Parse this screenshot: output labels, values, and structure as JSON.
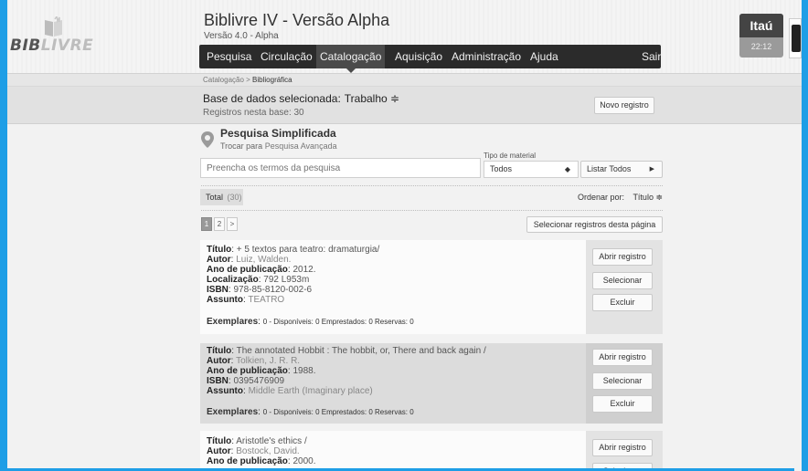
{
  "header": {
    "logo_left": "BIB",
    "logo_right": "LIVRE",
    "app_title": "Biblivre IV - Versão Alpha",
    "app_version": "Versão 4.0 - Alpha",
    "menu": [
      "Pesquisa",
      "Circulação",
      "Catalogação",
      "Aquisição",
      "Administração",
      "Ajuda"
    ],
    "logout": "Sair",
    "bank_name": "Itaú",
    "bank_time": "22:12"
  },
  "breadcrumb": {
    "parent": "Catalogação",
    "separator": " > ",
    "current": "Bibliográfica"
  },
  "database": {
    "label": "Base de dados selecionada:",
    "value": "Trabalho ≑",
    "count_text": "Registros nesta base: 30",
    "new_record_button": "Novo registro"
  },
  "search": {
    "title": "Pesquisa Simplificada",
    "switch_prefix": "Trocar para ",
    "switch_link": "Pesquisa Avançada",
    "placeholder": "Preencha os termos da pesquisa",
    "material_label": "Tipo de material",
    "material_value": "Todos",
    "list_all_button": "Listar Todos"
  },
  "results": {
    "total_label": "Total",
    "total_count": "(30)",
    "sort_label": "Ordenar por:",
    "sort_value": "Título ≑",
    "pages": [
      "1",
      "2",
      ">"
    ],
    "select_page_button": "Selecionar registros desta página"
  },
  "labels": {
    "title": "Título",
    "author": "Autor",
    "year": "Ano de publicação",
    "location": "Localização",
    "isbn": "ISBN",
    "subject": "Assunto",
    "copies": "Exemplares",
    "copies_detail": "0 - Disponíveis: 0  Emprestados: 0  Reservas: 0",
    "open_button": "Abrir registro",
    "select_button": "Selecionar",
    "delete_button": "Excluir"
  },
  "records": [
    {
      "title": "+ 5 textos para teatro: dramaturgia/",
      "author": "Luiz, Walden.",
      "year": "2012.",
      "location": "792 L953m",
      "isbn": "978-85-8120-002-6",
      "subject": "TEATRO"
    },
    {
      "title": "The annotated Hobbit : The hobbit, or, There and back again /",
      "author": "Tolkien, J. R. R.",
      "year": "1988.",
      "isbn": "0395476909",
      "subject": "Middle Earth (Imaginary place)"
    },
    {
      "title": "Aristotle's ethics /",
      "author": "Bostock, David.",
      "year": "2000."
    }
  ]
}
